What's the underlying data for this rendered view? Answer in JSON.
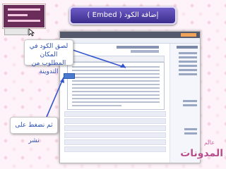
{
  "title": "إضافة الكود ( Embed )",
  "callouts": {
    "paste": [
      "لصق الكود في المكان",
      "المطلوب من التدوينة"
    ],
    "publish": "ثم نضغط على نشر"
  },
  "logo": {
    "small": "عالم",
    "big": "المدونات"
  },
  "colors": {
    "accent": "#4b3aa6",
    "callout_text": "#2c4fb3",
    "logo": "#b74c8c"
  }
}
